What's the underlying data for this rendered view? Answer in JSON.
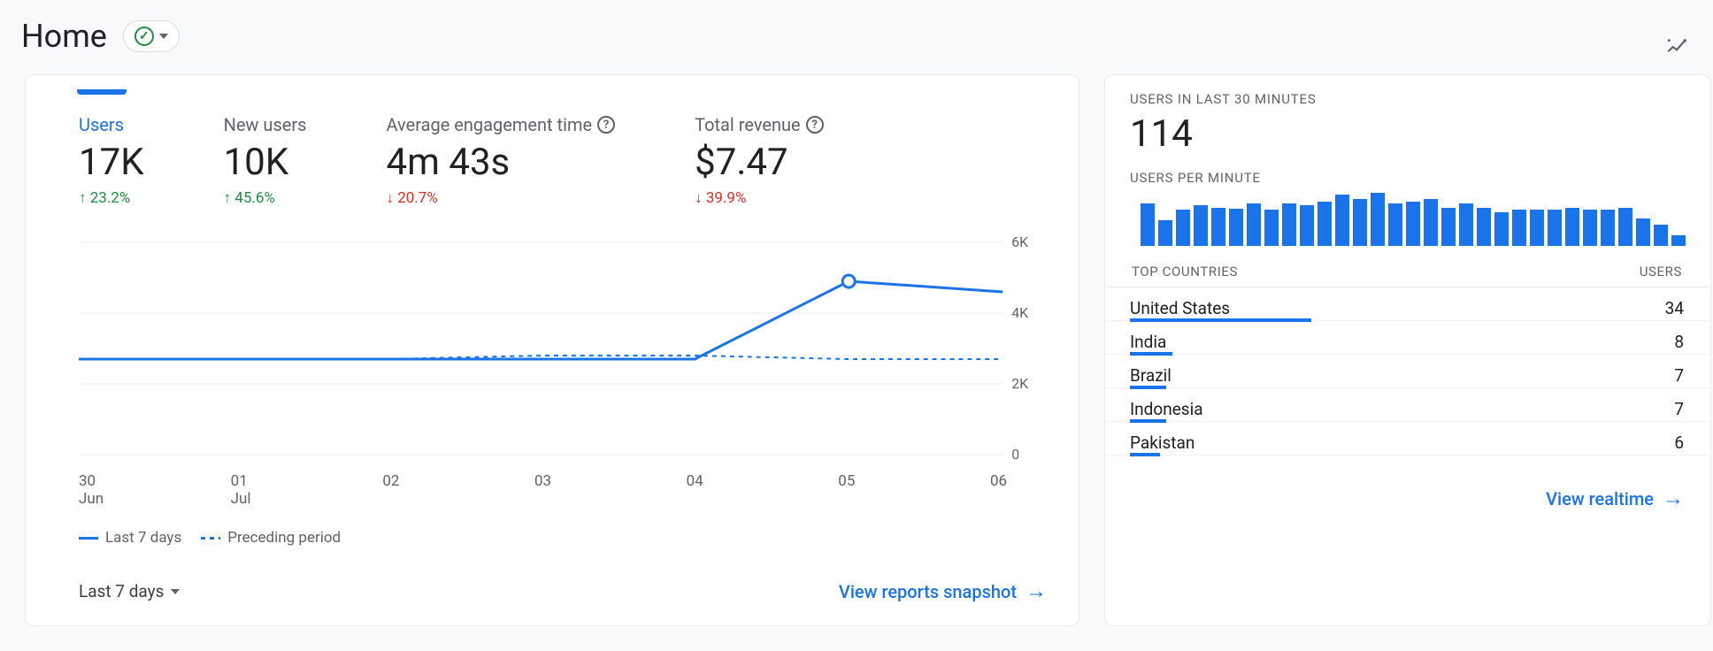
{
  "header": {
    "title": "Home"
  },
  "metrics": [
    {
      "label": "Users",
      "value": "17K",
      "delta": "23.2%",
      "dir": "up",
      "active": true,
      "help": false
    },
    {
      "label": "New users",
      "value": "10K",
      "delta": "45.6%",
      "dir": "up",
      "active": false,
      "help": false
    },
    {
      "label": "Average engagement time",
      "value": "4m 43s",
      "delta": "20.7%",
      "dir": "down",
      "active": false,
      "help": true
    },
    {
      "label": "Total revenue",
      "value": "$7.47",
      "delta": "39.9%",
      "dir": "down",
      "active": false,
      "help": true
    }
  ],
  "chart_data": {
    "type": "line",
    "x": [
      "30 Jun",
      "01 Jul",
      "02",
      "03",
      "04",
      "05",
      "06"
    ],
    "series": [
      {
        "name": "Last 7 days",
        "values": [
          2700,
          2700,
          2700,
          2700,
          2700,
          4900,
          4600
        ],
        "style": "solid",
        "highlight_index": 5
      },
      {
        "name": "Preceding period",
        "values": [
          2700,
          2700,
          2700,
          2800,
          2800,
          2700,
          2700
        ],
        "style": "dashed"
      }
    ],
    "ylim": [
      0,
      6000
    ],
    "yticks": [
      0,
      2000,
      4000,
      6000
    ],
    "ytick_labels": [
      "0",
      "2K",
      "4K",
      "6K"
    ]
  },
  "legend": [
    "Last 7 days",
    "Preceding period"
  ],
  "range_selector": "Last 7 days",
  "left_link": "View reports snapshot",
  "realtime": {
    "heading": "USERS IN LAST 30 MINUTES",
    "value": "114",
    "sublabel": "USERS PER MINUTE",
    "spark": [
      40,
      24,
      34,
      38,
      36,
      35,
      40,
      34,
      40,
      38,
      42,
      48,
      44,
      50,
      40,
      42,
      44,
      36,
      40,
      36,
      32,
      34,
      34,
      34,
      36,
      34,
      34,
      36,
      26,
      20,
      10
    ],
    "countries_header": {
      "left": "TOP COUNTRIES",
      "right": "USERS"
    },
    "countries": [
      {
        "name": "United States",
        "users": 34,
        "bar": 30
      },
      {
        "name": "India",
        "users": 8,
        "bar": 7
      },
      {
        "name": "Brazil",
        "users": 7,
        "bar": 6
      },
      {
        "name": "Indonesia",
        "users": 7,
        "bar": 6
      },
      {
        "name": "Pakistan",
        "users": 6,
        "bar": 5
      }
    ],
    "link": "View realtime"
  }
}
